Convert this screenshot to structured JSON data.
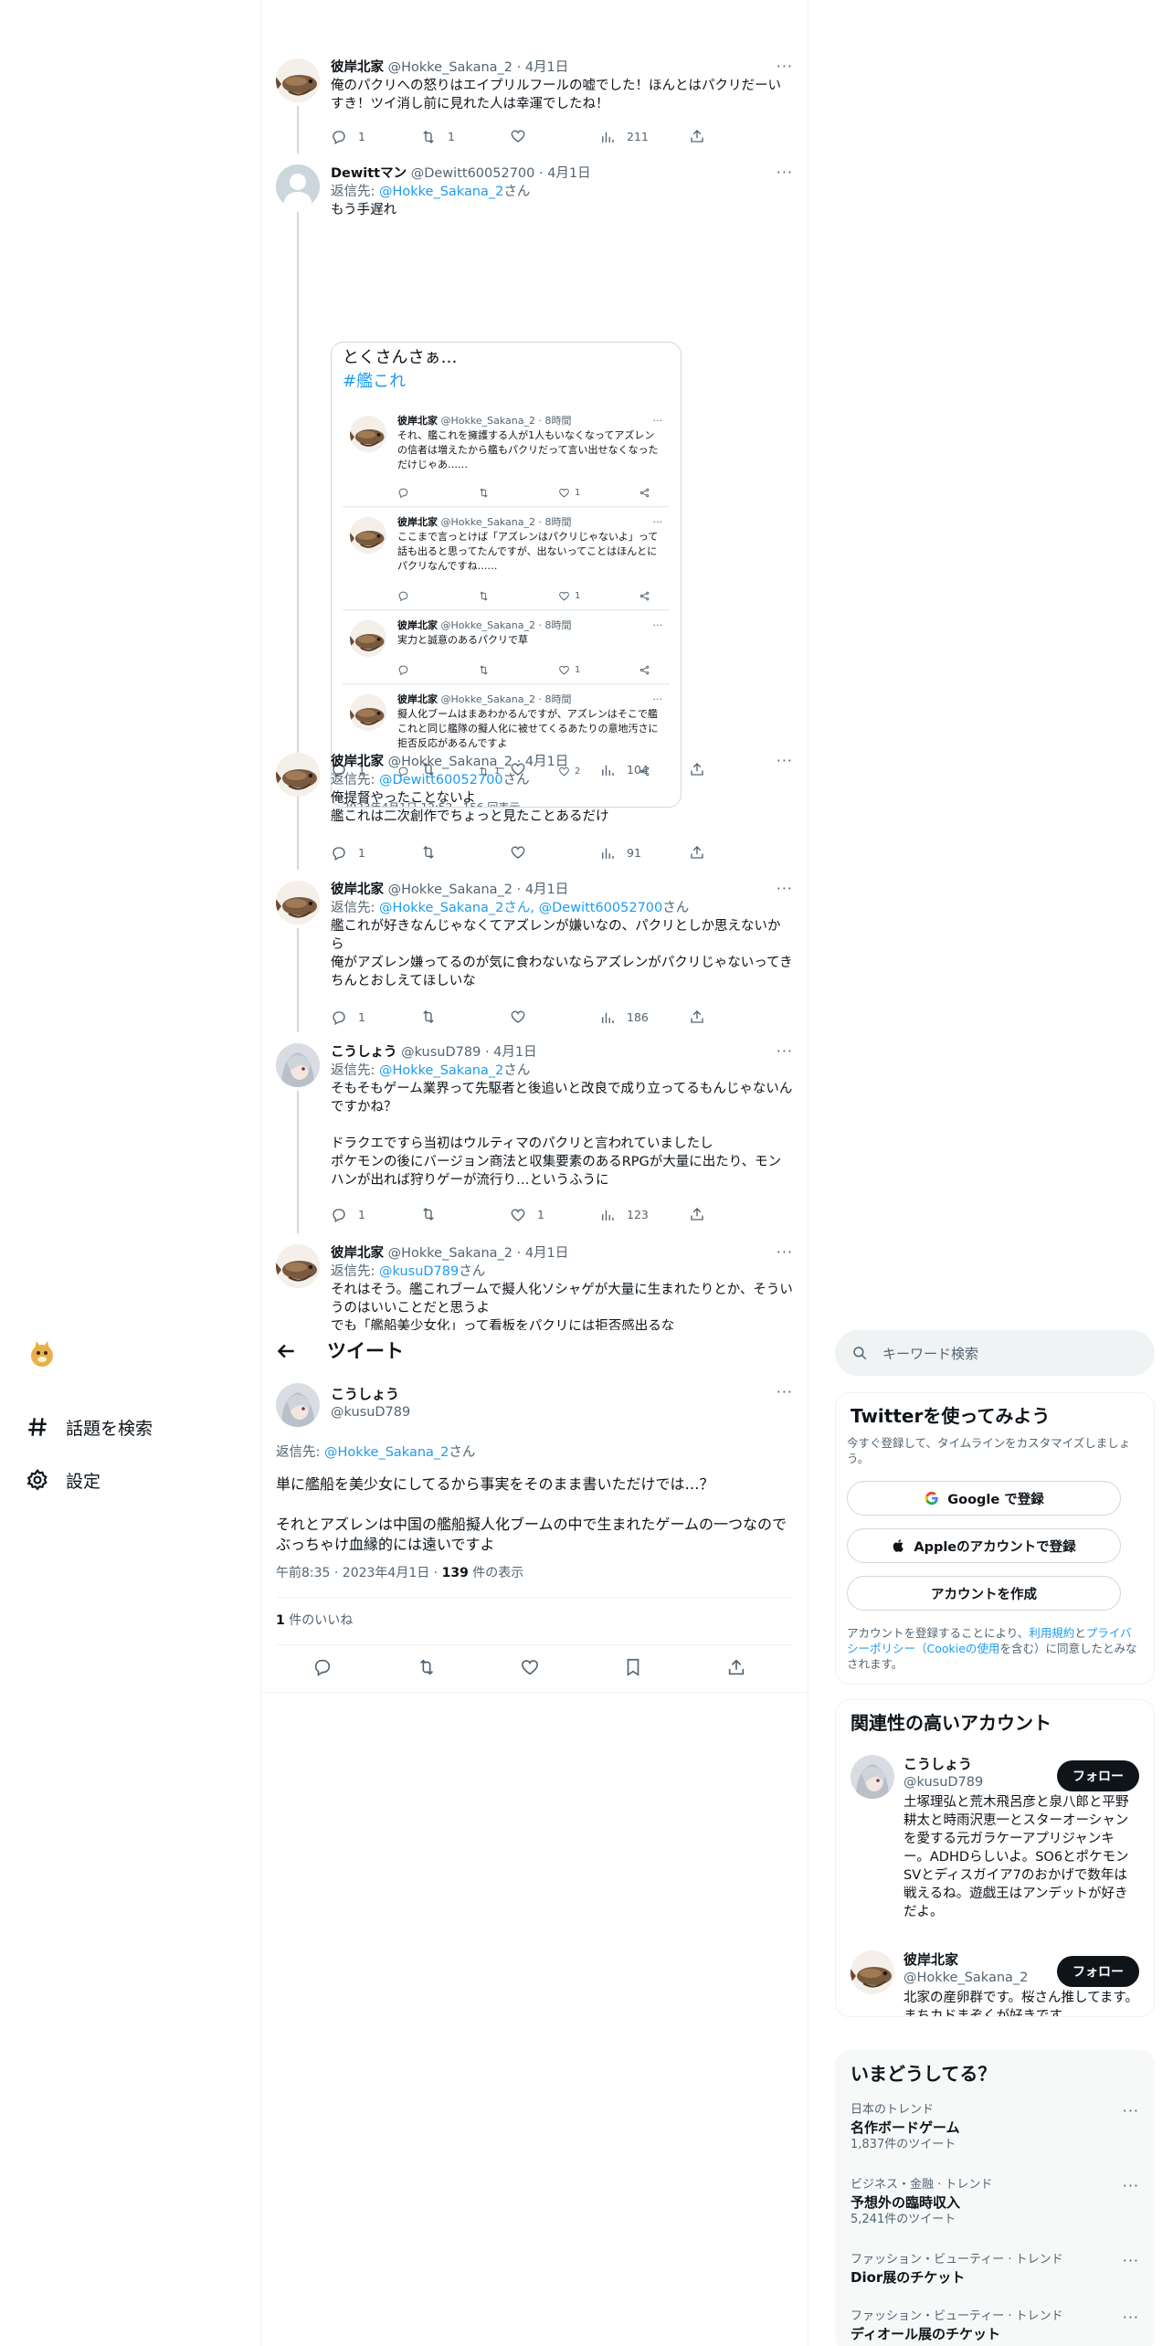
{
  "thread": {
    "tweets": [
      {
        "name": "彼岸北家",
        "handle": "@Hokke_Sakana_2 · 4月1日",
        "reply_prefix": "",
        "reply_to": "",
        "reply_suffix": "",
        "text": "俺のパクリへの怒りはエイプリルフールの嘘でした！ほんとはパクリだーいすき！ツイ消し前に見れた人は幸運でしたね！",
        "replies": "1",
        "retweets": "1",
        "likes": "",
        "views": "211"
      },
      {
        "name": "Dewittマン",
        "handle": "@Dewitt60052700 · 4月1日",
        "reply_prefix": "返信先: ",
        "reply_to": "@Hokke_Sakana_2",
        "reply_suffix": "さん",
        "text": "もう手遅れ",
        "replies": "1",
        "retweets": "",
        "likes": "",
        "views": "104"
      },
      {
        "name": "彼岸北家",
        "handle": "@Hokke_Sakana_2 · 4月1日",
        "reply_prefix": "返信先: ",
        "reply_to": "@Dewitt60052700",
        "reply_suffix": "さん",
        "text": "俺提督やったことないよ\n艦これは二次創作でちょっと見たことあるだけ",
        "replies": "1",
        "retweets": "",
        "likes": "",
        "views": "91"
      },
      {
        "name": "彼岸北家",
        "handle": "@Hokke_Sakana_2 · 4月1日",
        "reply_prefix": "返信先: ",
        "reply_to": "@Hokke_Sakana_2さん, @Dewitt60052700",
        "reply_suffix": "さん",
        "text": "艦これが好きなんじゃなくてアズレンが嫌いなの、パクリとしか思えないから\n俺がアズレン嫌ってるのが気に食わないならアズレンがパクリじゃないってきちんとおしえてほしいな",
        "replies": "1",
        "retweets": "",
        "likes": "",
        "views": "186"
      },
      {
        "name": "こうしょう",
        "handle": "@kusuD789 · 4月1日",
        "reply_prefix": "返信先: ",
        "reply_to": "@Hokke_Sakana_2",
        "reply_suffix": "さん",
        "text": "そもそもゲーム業界って先駆者と後追いと改良で成り立ってるもんじゃないんですかね？\n\nドラクエですら当初はウルティマのパクリと言われていましたし\nポケモンの後にバージョン商法と収集要素のあるRPGが大量に出たり、モンハンが出れば狩りゲーが流行り…というふうに",
        "replies": "1",
        "retweets": "",
        "likes": "1",
        "views": "123"
      },
      {
        "name": "彼岸北家",
        "handle": "@Hokke_Sakana_2 · 4月1日",
        "reply_prefix": "返信先: ",
        "reply_to": "@kusuD789",
        "reply_suffix": "さん",
        "text": "それはそう。艦これブームで擬人化ソシャゲが大量に生まれたりとか、そういうのはいいことだと思うよ\nでも「艦船美少女化」って看板をパクリには拒否感出るな",
        "replies": "",
        "retweets": "",
        "likes": "",
        "views": ""
      }
    ],
    "quote_card": {
      "title": "とくさんさぁ…",
      "hashtag": "#艦これ",
      "footer": "2023年4月1日 12:52 · 156 回表示",
      "items": [
        {
          "name": "彼岸北家",
          "meta": "@Hokke_Sakana_2 · 8時間",
          "text": "それ、艦これを擁護する人が1人もいなくなってアズレンの信者は増えたから艦もパクリだって言い出せなくなっただけじゃあ……",
          "likes": "1",
          "retweets": ""
        },
        {
          "name": "彼岸北家",
          "meta": "@Hokke_Sakana_2 · 8時間",
          "text": "ここまで言っとけば「アズレンはパクリじゃないよ」って話も出ると思ってたんですが、出ないってことはほんとにパクリなんですね……",
          "likes": "1",
          "retweets": ""
        },
        {
          "name": "彼岸北家",
          "meta": "@Hokke_Sakana_2 · 8時間",
          "text": "実力と誠意のあるパクリで草",
          "likes": "1",
          "retweets": ""
        },
        {
          "name": "彼岸北家",
          "meta": "@Hokke_Sakana_2 · 8時間",
          "text": "擬人化ブームはまあわかるんですが、アズレンはそこで艦これと同じ艦隊の擬人化に被せてくるあたりの意地汚さに拒否反応があるんですよ",
          "likes": "2",
          "retweets": "1"
        }
      ]
    }
  },
  "sidebar": {
    "items": [
      {
        "label": "話題を検索",
        "icon": "hashtag-icon"
      },
      {
        "label": "設定",
        "icon": "gear-icon"
      }
    ]
  },
  "main": {
    "header_title": "ツイート",
    "tweet": {
      "name": "こうしょう",
      "handle": "@kusuD789",
      "reply_prefix": "返信先: ",
      "reply_to": "@Hokke_Sakana_2",
      "reply_suffix": "さん",
      "text": "単に艦船を美少女にしてるから事実をそのまま書いただけでは…？\n\nそれとアズレンは中国の艦船擬人化ブームの中で生まれたゲームの一つなのでぶっちゃけ血縁的には遠いですよ",
      "time": "午前8:35 · 2023年4月1日 · ",
      "views": "139",
      "views_suffix": " 件の表示",
      "likes_count": "1",
      "likes_suffix": " 件のいいね"
    }
  },
  "right": {
    "search_placeholder": "キーワード検索",
    "signup": {
      "title": "Twitterを使ってみよう",
      "desc": "今すぐ登録して、タイムラインをカスタマイズしましょう。",
      "google": "Google で登録",
      "apple": "Appleのアカウントで登録",
      "create": "アカウントを作成",
      "terms_1": "アカウントを登録することにより、",
      "terms_link1": "利用規約",
      "terms_2": "と",
      "terms_link2": "プライバシーポリシー（Cookieの使用",
      "terms_3": "を含む）に同意したとみなされます。"
    },
    "related": {
      "title": "関連性の高いアカウント",
      "accounts": [
        {
          "name": "こうしょう",
          "handle": "@kusuD789",
          "bio": "土塚理弘と荒木飛呂彦と泉八郎と平野耕太と時雨沢恵一とスターオーシャンを愛する元ガラケーアプリジャンキー。ADHDらしいよ。SO6とポケモンSVとディスガイア7のおかげで数年は戦えるね。遊戯王はアンデットが好きだよ。",
          "follow": "フォロー"
        },
        {
          "name": "彼岸北家",
          "handle": "@Hokke_Sakana_2",
          "bio": "北家の産卵群です。桜さん推してます。まちカドまぞくが好きです。",
          "follow": "フォロー"
        }
      ]
    },
    "trends": {
      "title": "いまどうしてる？",
      "items": [
        {
          "context": "日本のトレンド",
          "name": "名作ボードゲーム",
          "count": "1,837件のツイート"
        },
        {
          "context": "ビジネス・金融 · トレンド",
          "name": "予想外の臨時収入",
          "count": "5,241件のツイート"
        },
        {
          "context": "ファッション・ビューティー · トレンド",
          "name": "Dior展のチケット",
          "count": ""
        },
        {
          "context": "ファッション・ビューティー · トレンド",
          "name": "ディオール展のチケット",
          "count": ""
        }
      ]
    }
  }
}
